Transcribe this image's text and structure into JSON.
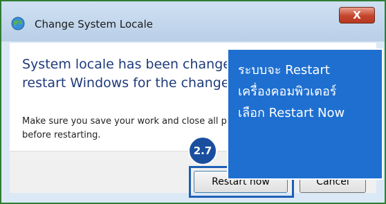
{
  "window": {
    "title": "Change System Locale",
    "close_label": "X"
  },
  "dialog": {
    "main_line1": "System locale has been changed. You must",
    "main_line2": "restart Windows for the change to take effect.",
    "sub_line1": "Make sure you save your work and close all programs",
    "sub_line2": "before restarting."
  },
  "buttons": {
    "restart_label": "Restart now",
    "cancel_label": "Cancel"
  },
  "annotation": {
    "step_badge": "2.7",
    "callout_line1": "ระบบจะ Restart",
    "callout_line2": "เครื่องคอมพิวเตอร์",
    "callout_line3": "เลือก Restart  Now"
  },
  "colors": {
    "frame_border": "#2e7d32",
    "callout_bg": "#1e6fd0",
    "badge_bg": "#1a4fa0",
    "highlight_border": "#1d5fb6"
  },
  "icons": {
    "app_icon": "globe-icon",
    "close": "close-icon"
  }
}
